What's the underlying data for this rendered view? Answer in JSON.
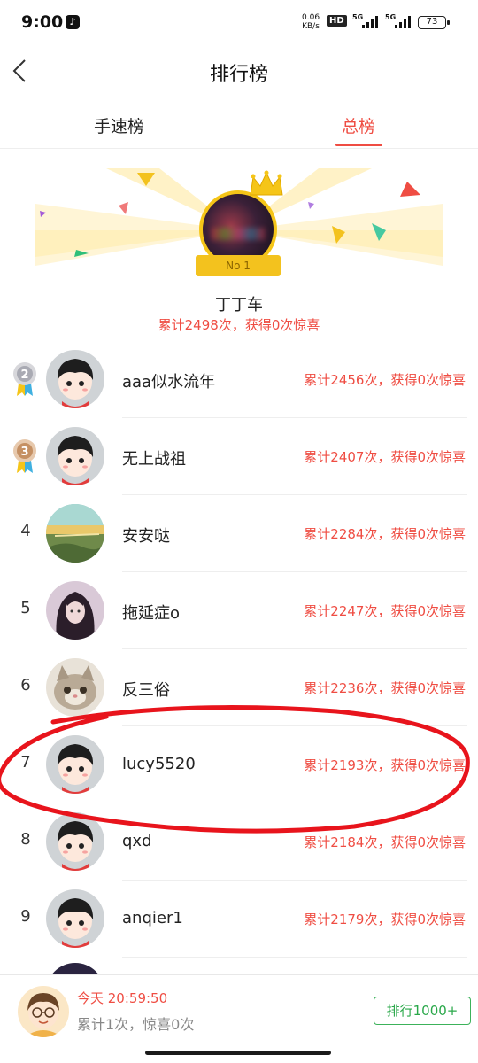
{
  "status_bar": {
    "time": "9:00",
    "net_speed_value": "0.06",
    "net_speed_unit": "KB/s",
    "hd_label": "HD",
    "signal_1": "5G",
    "signal_2": "5G",
    "battery": "73"
  },
  "header": {
    "title": "排行榜"
  },
  "tabs": [
    {
      "label": "手速榜",
      "active": false
    },
    {
      "label": "总榜",
      "active": true
    }
  ],
  "top_entry": {
    "badge": "No 1",
    "name": "丁丁车",
    "stat": "累计2498次，获得0次惊喜"
  },
  "ranking": [
    {
      "rank": "2",
      "name": "aaa似水流年",
      "stat": "累计2456次，获得0次惊喜",
      "medal": "silver"
    },
    {
      "rank": "3",
      "name": "无上战祖",
      "stat": "累计2407次，获得0次惊喜",
      "medal": "bronze"
    },
    {
      "rank": "4",
      "name": "安安哒",
      "stat": "累计2284次，获得0次惊喜"
    },
    {
      "rank": "5",
      "name": "拖延症o",
      "stat": "累计2247次，获得0次惊喜"
    },
    {
      "rank": "6",
      "name": "反三俗",
      "stat": "累计2236次，获得0次惊喜"
    },
    {
      "rank": "7",
      "name": "lucy5520",
      "stat": "累计2193次，获得0次惊喜"
    },
    {
      "rank": "8",
      "name": "qxd",
      "stat": "累计2184次，获得0次惊喜"
    },
    {
      "rank": "9",
      "name": "anqier1",
      "stat": "累计2179次，获得0次惊喜"
    }
  ],
  "footer": {
    "time": "今天 20:59:50",
    "stat": "累计1次，惊喜0次",
    "rank_button": "排行1000+"
  },
  "colors": {
    "accent_red": "#ef4d43",
    "accent_green": "#3cb25a",
    "gold": "#f5c518"
  },
  "icons": [
    "back-icon",
    "crown-icon",
    "silver-medal-icon",
    "bronze-medal-icon"
  ]
}
